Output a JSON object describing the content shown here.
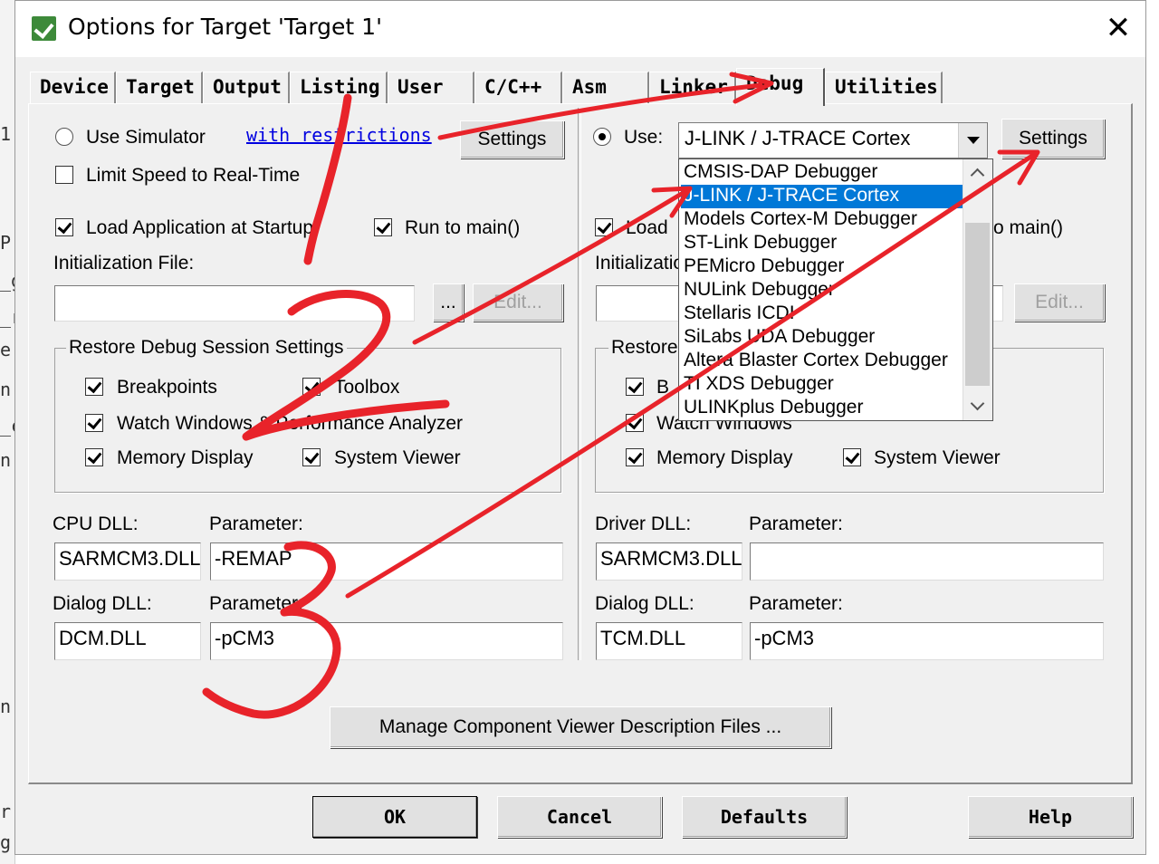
{
  "window": {
    "title": "Options for Target 'Target 1'"
  },
  "background_fragments": [
    "1",
    "P",
    "_g",
    "_r",
    "e.",
    "n",
    "_c",
    "n",
    "n",
    "r",
    "g"
  ],
  "tabs": [
    {
      "label": "Device"
    },
    {
      "label": "Target"
    },
    {
      "label": "Output"
    },
    {
      "label": "Listing"
    },
    {
      "label": "User"
    },
    {
      "label": "C/C++"
    },
    {
      "label": "Asm"
    },
    {
      "label": "Linker"
    },
    {
      "label": "Debug"
    },
    {
      "label": "Utilities"
    }
  ],
  "left": {
    "use_simulator": "Use Simulator",
    "with_restrictions": "with restrictions",
    "settings": "Settings",
    "limit_speed": "Limit Speed to Real-Time",
    "load_app": "Load Application at Startup",
    "run_to_main": "Run to main()",
    "init_file": "Initialization File:",
    "browse": "...",
    "edit": "Edit...",
    "restore_title": "Restore Debug Session Settings",
    "breakpoints": "Breakpoints",
    "toolbox": "Toolbox",
    "watch": "Watch Windows & Performance Analyzer",
    "memory": "Memory Display",
    "sysviewer": "System Viewer",
    "cpu_dll_label": "CPU DLL:",
    "param_label": "Parameter:",
    "cpu_dll": "SARMCM3.DLL",
    "cpu_param": "-REMAP",
    "dialog_dll_label": "Dialog DLL:",
    "dialog_dll": "DCM.DLL",
    "dialog_param": "-pCM3"
  },
  "right": {
    "use": "Use:",
    "debugger": "J-LINK / J-TRACE Cortex",
    "settings": "Settings",
    "load_app": "Load",
    "run_to_main": "o main()",
    "init_file": "Initializatio",
    "edit": "Edit...",
    "restore_title": "Restore",
    "breakpoints": "B",
    "watch": "Watch Windows",
    "memory": "Memory Display",
    "sysviewer": "System Viewer",
    "driver_dll_label": "Driver DLL:",
    "param_label": "Parameter:",
    "driver_dll": "SARMCM3.DLL",
    "driver_param": "",
    "dialog_dll_label": "Dialog DLL:",
    "dialog_dll": "TCM.DLL",
    "dialog_param": "-pCM3"
  },
  "dropdown": {
    "items": [
      "CMSIS-DAP Debugger",
      "J-LINK / J-TRACE Cortex",
      "Models Cortex-M Debugger",
      "ST-Link Debugger",
      "PEMicro Debugger",
      "NULink Debugger",
      "Stellaris ICDI",
      "SiLabs UDA Debugger",
      "Altera Blaster Cortex Debugger",
      "TI XDS Debugger",
      "ULINKplus Debugger"
    ],
    "selected_index": 1
  },
  "manage_button": "Manage Component Viewer Description Files ...",
  "footer": {
    "ok": "OK",
    "cancel": "Cancel",
    "defaults": "Defaults",
    "help": "Help"
  },
  "annotations": {
    "color": "#e8232a",
    "numbers": [
      "1",
      "2",
      "3"
    ]
  }
}
